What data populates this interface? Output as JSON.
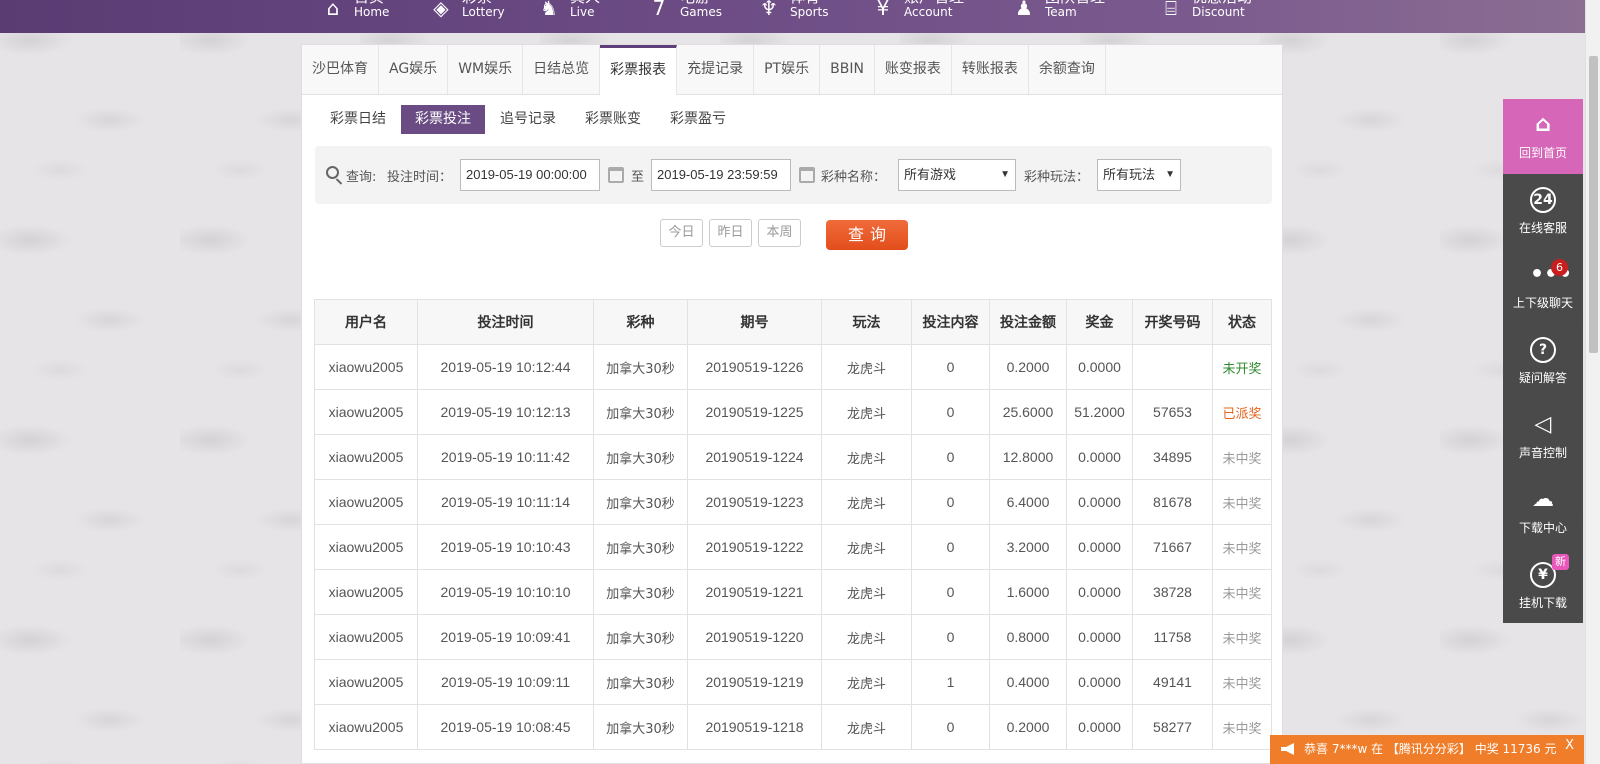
{
  "nav": [
    {
      "cn": "首页",
      "en": "Home",
      "icon": "home-icon",
      "glyph": "⌂"
    },
    {
      "cn": "彩票",
      "en": "Lottery",
      "icon": "ticket-icon",
      "glyph": "◈"
    },
    {
      "cn": "真人",
      "en": "Live",
      "icon": "dragon-icon",
      "glyph": "♞"
    },
    {
      "cn": "电游",
      "en": "Games",
      "icon": "seven-icon",
      "glyph": "7"
    },
    {
      "cn": "体育",
      "en": "Sports",
      "icon": "trophy-icon",
      "glyph": "♆"
    },
    {
      "cn": "账户管理",
      "en": "Account",
      "icon": "yen-icon",
      "glyph": "¥"
    },
    {
      "cn": "团队管理",
      "en": "Team",
      "icon": "team-icon",
      "glyph": "♟"
    },
    {
      "cn": "优惠活动",
      "en": "Discount",
      "icon": "gift-icon",
      "glyph": "⌸"
    }
  ],
  "tabs": [
    "沙巴体育",
    "AG娱乐",
    "WM娱乐",
    "日结总览",
    "彩票报表",
    "充提记录",
    "PT娱乐",
    "BBIN",
    "账变报表",
    "转账报表",
    "余额查询"
  ],
  "active_tab": "彩票报表",
  "subtabs": [
    "彩票日结",
    "彩票投注",
    "追号记录",
    "彩票账变",
    "彩票盈亏"
  ],
  "active_subtab": "彩票投注",
  "query": {
    "search_label": "查询:",
    "time_label": "投注时间：",
    "start": "2019-05-19 00:00:00",
    "to": "至",
    "end": "2019-05-19 23:59:59",
    "game_label": "彩种名称：",
    "game_value": "所有游戏",
    "play_label": "彩种玩法：",
    "play_value": "所有玩法"
  },
  "quick_buttons": [
    "今日",
    "昨日",
    "本周"
  ],
  "query_button": "查询",
  "table": {
    "headers": [
      "用户名",
      "投注时间",
      "彩种",
      "期号",
      "玩法",
      "投注内容",
      "投注金额",
      "奖金",
      "开奖号码",
      "状态"
    ],
    "rows": [
      [
        "xiaowu2005",
        "2019-05-19 10:12:44",
        "加拿大30秒",
        "20190519-1226",
        "龙虎斗",
        "0",
        "0.2000",
        "0.0000",
        "",
        "未开奖"
      ],
      [
        "xiaowu2005",
        "2019-05-19 10:12:13",
        "加拿大30秒",
        "20190519-1225",
        "龙虎斗",
        "0",
        "25.6000",
        "51.2000",
        "57653",
        "已派奖"
      ],
      [
        "xiaowu2005",
        "2019-05-19 10:11:42",
        "加拿大30秒",
        "20190519-1224",
        "龙虎斗",
        "0",
        "12.8000",
        "0.0000",
        "34895",
        "未中奖"
      ],
      [
        "xiaowu2005",
        "2019-05-19 10:11:14",
        "加拿大30秒",
        "20190519-1223",
        "龙虎斗",
        "0",
        "6.4000",
        "0.0000",
        "81678",
        "未中奖"
      ],
      [
        "xiaowu2005",
        "2019-05-19 10:10:43",
        "加拿大30秒",
        "20190519-1222",
        "龙虎斗",
        "0",
        "3.2000",
        "0.0000",
        "71667",
        "未中奖"
      ],
      [
        "xiaowu2005",
        "2019-05-19 10:10:10",
        "加拿大30秒",
        "20190519-1221",
        "龙虎斗",
        "0",
        "1.6000",
        "0.0000",
        "38728",
        "未中奖"
      ],
      [
        "xiaowu2005",
        "2019-05-19 10:09:41",
        "加拿大30秒",
        "20190519-1220",
        "龙虎斗",
        "0",
        "0.8000",
        "0.0000",
        "11758",
        "未中奖"
      ],
      [
        "xiaowu2005",
        "2019-05-19 10:09:11",
        "加拿大30秒",
        "20190519-1219",
        "龙虎斗",
        "1",
        "0.4000",
        "0.0000",
        "49141",
        "未中奖"
      ],
      [
        "xiaowu2005",
        "2019-05-19 10:08:45",
        "加拿大30秒",
        "20190519-1218",
        "龙虎斗",
        "0",
        "0.2000",
        "0.0000",
        "58277",
        "未中奖"
      ]
    ]
  },
  "sidebar": [
    {
      "label": "回到首页",
      "icon": "home-icon",
      "glyph": "⌂"
    },
    {
      "label": "在线客服",
      "icon": "headset-24-icon",
      "glyph": "24"
    },
    {
      "label": "上下级聊天",
      "icon": "chat-bubble-icon",
      "glyph": "•••",
      "badge": "6"
    },
    {
      "label": "疑问解答",
      "icon": "question-icon",
      "glyph": "?"
    },
    {
      "label": "声音控制",
      "icon": "speaker-icon",
      "glyph": "◁"
    },
    {
      "label": "下载中心",
      "icon": "cloud-download-icon",
      "glyph": "☁"
    },
    {
      "label": "挂机下载",
      "icon": "money-bag-icon",
      "glyph": "¥",
      "badge_new": "新"
    }
  ],
  "toast": {
    "text": "恭喜 7***w 在 【腾讯分分彩】 中奖 11736 元",
    "close": "X"
  },
  "colors": {
    "nav": "#5a3b72",
    "accent": "#6a4b83",
    "query_button": "#e85a24",
    "sidebar_home": "#d667b8",
    "toast": "#f07d2a"
  }
}
